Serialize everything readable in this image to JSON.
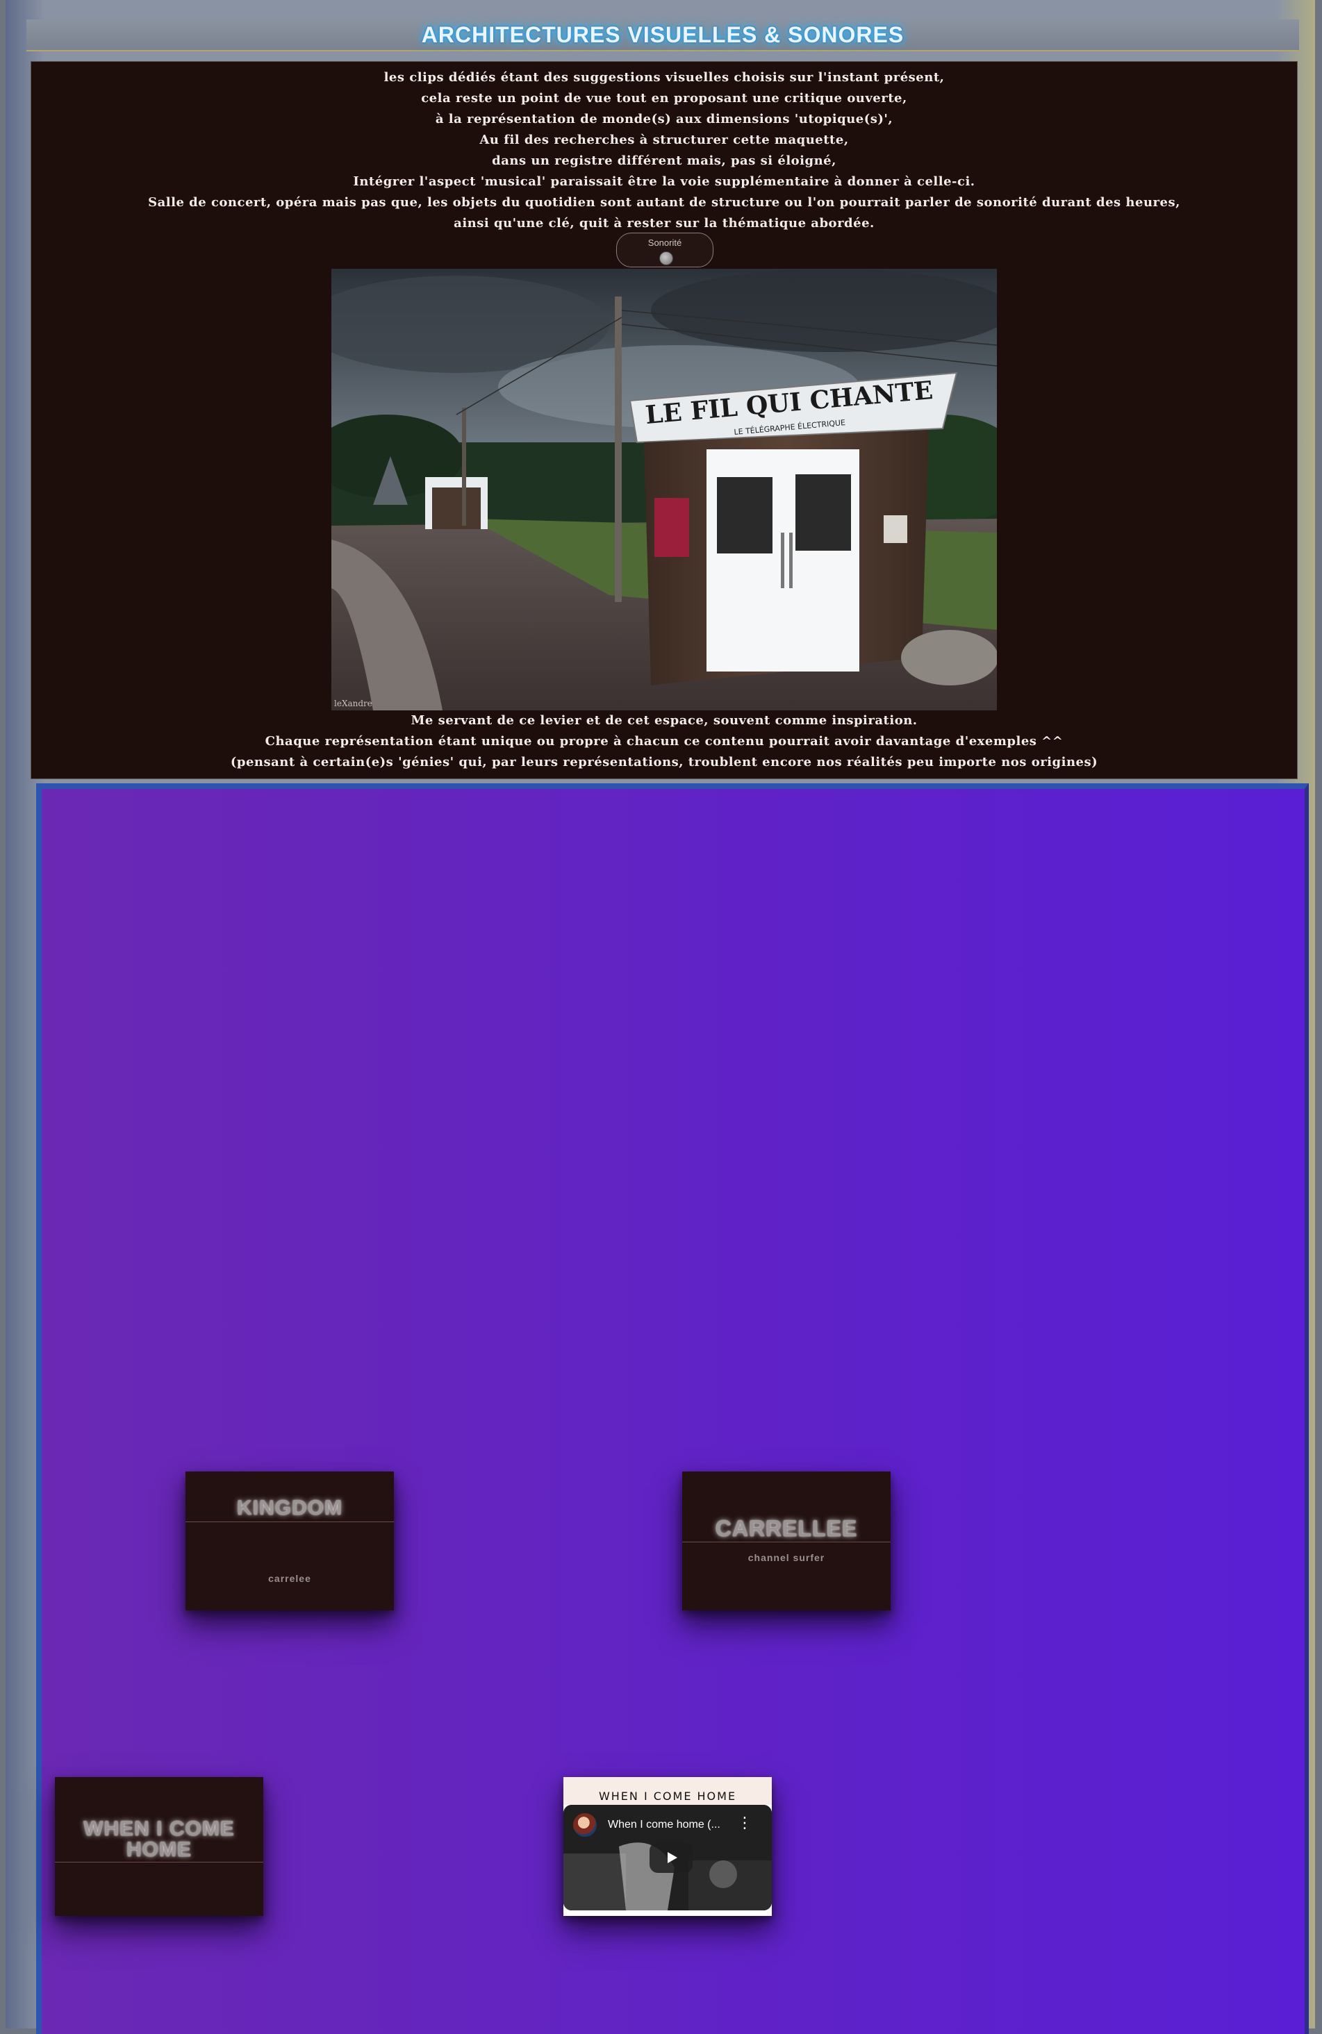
{
  "header": {
    "title": "ARCHITECTURES VISUELLES & SONORES"
  },
  "intro": {
    "lines": [
      "les clips dédiés étant des suggestions visuelles choisis sur l'instant présent,",
      "cela reste un point de vue tout en proposant une critique ouverte,",
      "à la représentation de monde(s) aux dimensions 'utopique(s)',",
      "Au fil des recherches à structurer cette maquette,",
      "dans un registre différent mais, pas si éloigné,",
      "Intégrer l'aspect 'musical' paraissait être la voie supplémentaire à donner à celle-ci.",
      "Salle de concert, opéra mais pas que, les objets du quotidien sont autant de structure ou l'on pourrait parler de sonorité durant des heures,",
      "ainsi qu'une clé, quit à rester sur la thématique abordée."
    ]
  },
  "sound_toggle": {
    "label": "Sonorité"
  },
  "photo": {
    "sign_main": "LE FIL QUI CHANTE",
    "sign_sub": "LE TÉLÉGRAPHE ÉLECTRIQUE",
    "watermark": "leXandre"
  },
  "outro": {
    "lines": [
      "Me servant de ce levier et de cet espace, souvent comme inspiration.",
      "Chaque représentation étant unique ou propre à chacun ce contenu pourrait avoir davantage d'exemples ^^",
      "(pensant à certain(e)s 'génies' qui, par leurs représentations, troublent encore nos réalités peu importe nos origines)"
    ]
  },
  "videos": [
    {
      "title": "KINGDOM",
      "subtitle": "carrelee"
    },
    {
      "title": "CARRELLEE",
      "subtitle": "channel surfer"
    },
    {
      "title_line1": "WHEN I COME",
      "title_line2": "HOME"
    },
    {
      "header": "WHEN I COME HOME",
      "player_title": "When I come home (...",
      "menu": "⋮"
    }
  ],
  "colors": {
    "header_glow": "#2fb6ff",
    "panel_bg": "#1e0e0b",
    "video_bg_start": "#6a28b3",
    "video_bg_end": "#5a1fd4"
  }
}
